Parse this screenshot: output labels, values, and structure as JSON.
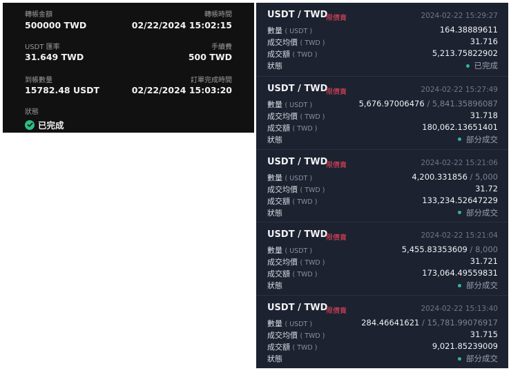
{
  "transfer": {
    "amount_label": "轉帳金額",
    "amount_value": "500000 TWD",
    "time_label": "轉帳時間",
    "time_value": "02/22/2024 15:02:15",
    "rate_label": "USDT 匯率",
    "rate_value": "31.649 TWD",
    "fee_label": "手續費",
    "fee_value": "500 TWD",
    "received_label": "到帳數量",
    "received_value": "15782.48 USDT",
    "completed_label": "訂單完成時間",
    "completed_value": "02/22/2024 15:03:20",
    "status_label": "狀態",
    "status_value": "已完成"
  },
  "labels": {
    "qty": "數量",
    "qty_unit": "( USDT )",
    "avg": "成交均價",
    "avg_unit": "( TWD )",
    "amt": "成交額",
    "amt_unit": "( TWD )",
    "status": "狀態"
  },
  "orders": [
    {
      "pair": "USDT / TWD",
      "type": "限價賣",
      "time": "2024-02-22 15:29:27",
      "qty": "164.38889611",
      "qty_total": "",
      "avg_price": "31.716",
      "amount": "5,213.75822902",
      "status": "已完成"
    },
    {
      "pair": "USDT / TWD",
      "type": "限價賣",
      "time": "2024-02-22 15:27:49",
      "qty": "5,676.97006476",
      "qty_total": " / 5,841.35896087",
      "avg_price": "31.718",
      "amount": "180,062.13651401",
      "status": "部分成交"
    },
    {
      "pair": "USDT / TWD",
      "type": "限價賣",
      "time": "2024-02-22 15:21:06",
      "qty": "4,200.331856",
      "qty_total": " / 5,000",
      "avg_price": "31.72",
      "amount": "133,234.52647229",
      "status": "部分成交"
    },
    {
      "pair": "USDT / TWD",
      "type": "限價賣",
      "time": "2024-02-22 15:21:04",
      "qty": "5,455.83353609",
      "qty_total": " / 8,000",
      "avg_price": "31.721",
      "amount": "173,064.49559831",
      "status": "部分成交"
    },
    {
      "pair": "USDT / TWD",
      "type": "限價賣",
      "time": "2024-02-22 15:13:40",
      "qty": "284.46641621",
      "qty_total": " / 15,781.99076917",
      "avg_price": "31.715",
      "amount": "9,021.85239009",
      "status": "部分成交"
    }
  ]
}
